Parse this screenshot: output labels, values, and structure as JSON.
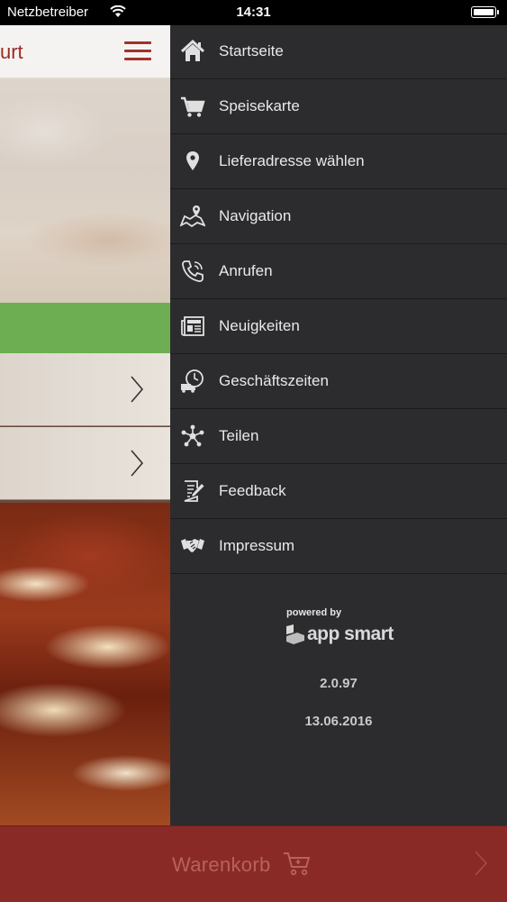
{
  "status_bar": {
    "carrier": "Netzbetreiber",
    "time": "14:31"
  },
  "app": {
    "title_fragment": "urt"
  },
  "menu": {
    "items": [
      {
        "label": "Startseite",
        "icon": "home-icon"
      },
      {
        "label": "Speisekarte",
        "icon": "cart-icon"
      },
      {
        "label": "Lieferadresse wählen",
        "icon": "location-pin-icon"
      },
      {
        "label": "Navigation",
        "icon": "map-icon"
      },
      {
        "label": "Anrufen",
        "icon": "phone-icon"
      },
      {
        "label": "Neuigkeiten",
        "icon": "news-icon"
      },
      {
        "label": "Geschäftszeiten",
        "icon": "delivery-clock-icon"
      },
      {
        "label": "Teilen",
        "icon": "share-icon"
      },
      {
        "label": "Feedback",
        "icon": "feedback-icon"
      },
      {
        "label": "Impressum",
        "icon": "handshake-icon"
      }
    ]
  },
  "footer": {
    "powered_by": "powered by",
    "brand": "app smart",
    "version": "2.0.97",
    "date": "13.06.2016"
  },
  "cart": {
    "label": "Warenkorb"
  },
  "colors": {
    "drawer_bg": "#2c2c2e",
    "cart_bar": "#8a2a26",
    "accent_red": "#a0312b",
    "green_banner": "#6dae52"
  }
}
